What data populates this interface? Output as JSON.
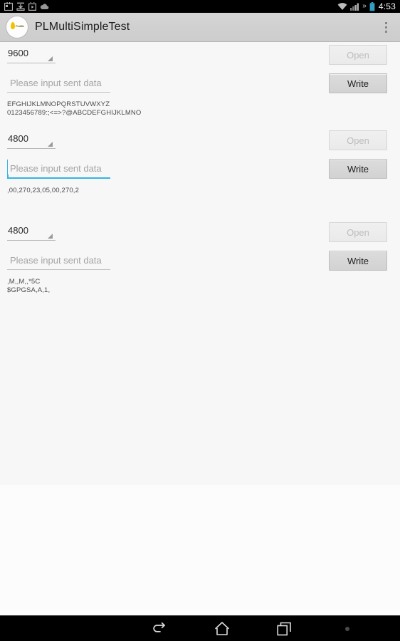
{
  "status_bar": {
    "icons": [
      "calendar-icon",
      "download-icon",
      "play-store-icon",
      "cloud-icon"
    ],
    "right_icons": [
      "wifi-icon",
      "signal-icon",
      "more-icons-chevron",
      "battery-icon"
    ],
    "more_glyph": "»",
    "clock": "4:53"
  },
  "action_bar": {
    "app_icon": "app-logo-icon",
    "brand_text": "Prolific",
    "title": "PLMultiSimpleTest",
    "overflow": "overflow-menu-icon"
  },
  "ports": [
    {
      "baud_rate": "9600",
      "input_value": "",
      "input_placeholder": "Please input sent data",
      "input_focused": false,
      "open_label": "Open",
      "open_enabled": false,
      "write_label": "Write",
      "write_enabled": true,
      "log": "EFGHIJKLMNOPQRSTUVWXYZ\n0123456789:;<=>?@ABCDEFGHIJKLMNO"
    },
    {
      "baud_rate": "4800",
      "input_value": "",
      "input_placeholder": "Please input sent data",
      "input_focused": true,
      "open_label": "Open",
      "open_enabled": false,
      "write_label": "Write",
      "write_enabled": true,
      "log": ",00,270,23,05,00,270,2"
    },
    {
      "baud_rate": "4800",
      "input_value": "",
      "input_placeholder": "Please input sent data",
      "input_focused": false,
      "open_label": "Open",
      "open_enabled": false,
      "write_label": "Write",
      "write_enabled": true,
      "log": ",M,,M,,*5C\n$GPGSA,A,1,"
    }
  ],
  "nav_bar": {
    "back": "back-icon",
    "home": "home-icon",
    "recents": "recent-apps-icon",
    "dot": "menu-dot-icon"
  },
  "colors": {
    "accent": "#33b5e5",
    "action_bar": "#d0d0d0",
    "content_bg": "#f7f7f7",
    "status_bar": "#000000"
  }
}
